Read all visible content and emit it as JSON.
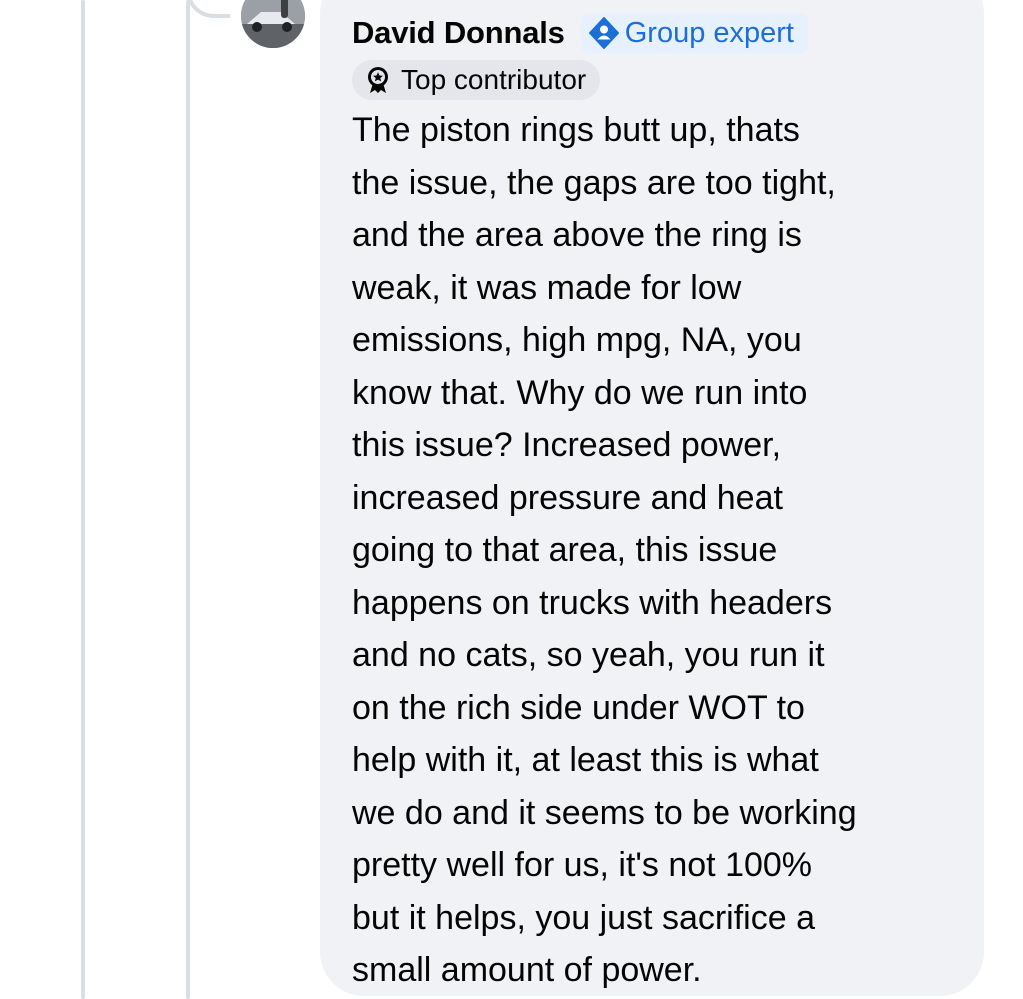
{
  "comment": {
    "author": {
      "name": "David Donnals",
      "avatar_icon": "user-avatar-photo"
    },
    "badges": {
      "group_expert": {
        "label": "Group expert",
        "icon": "expert-shield-icon",
        "color": "#1b6fd6"
      },
      "top_contributor": {
        "label": "Top contributor",
        "icon": "contributor-medal-icon"
      }
    },
    "lines": [
      "The piston rings butt up, thats",
      "the issue, the gaps are too tight,",
      "and the area above the ring is",
      "weak, it was made for low",
      "emissions, high mpg, NA, you",
      "know that. Why do we run into",
      "this issue? Increased power,",
      "increased pressure and heat",
      "going to that area, this issue",
      "happens on trucks with headers",
      "and no cats, so yeah, you run it",
      "on the rich side under WOT to",
      "help with it, at least this is what",
      "we do and it seems to be working",
      "pretty well for us, it's not 100%",
      "but it helps, you just sacrifice a",
      "small amount of power."
    ]
  },
  "colors": {
    "bubble_background": "#f0f2f5",
    "thread_line": "#dadde1",
    "text": "#050505"
  }
}
